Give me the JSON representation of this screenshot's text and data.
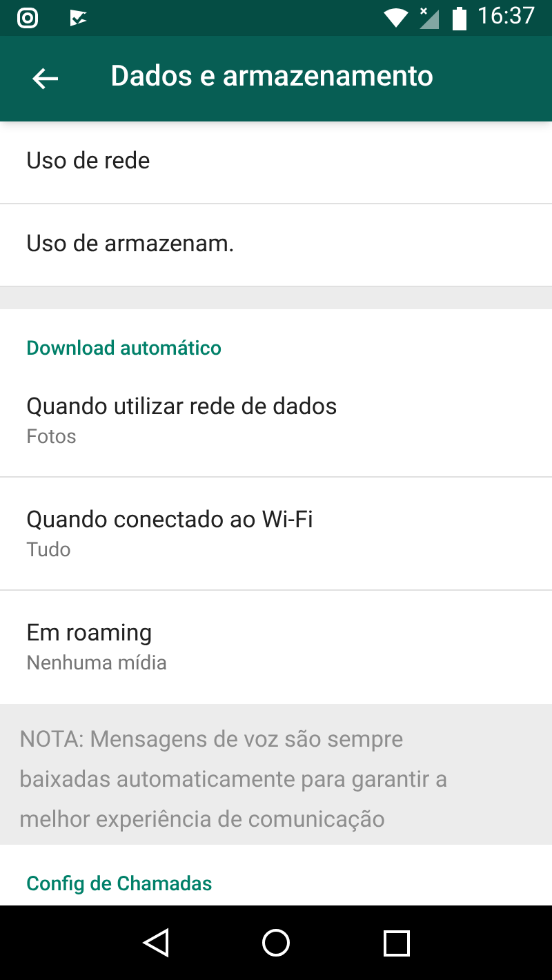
{
  "status_bar": {
    "time": "16:37"
  },
  "app_bar": {
    "title": "Dados e armazenamento"
  },
  "usage_items": [
    {
      "title": "Uso de rede"
    },
    {
      "title": "Uso de armazenam."
    }
  ],
  "auto_download": {
    "header": "Download automático",
    "items": [
      {
        "title": "Quando utilizar rede de dados",
        "value": "Fotos"
      },
      {
        "title": "Quando conectado ao Wi-Fi",
        "value": "Tudo"
      },
      {
        "title": "Em roaming",
        "value": "Nenhuma mídia"
      }
    ],
    "note": "NOTA: Mensagens de voz são sempre baixadas automaticamente para garantir a melhor experiência de comunicação"
  },
  "calls": {
    "header": "Config de Chamadas"
  }
}
